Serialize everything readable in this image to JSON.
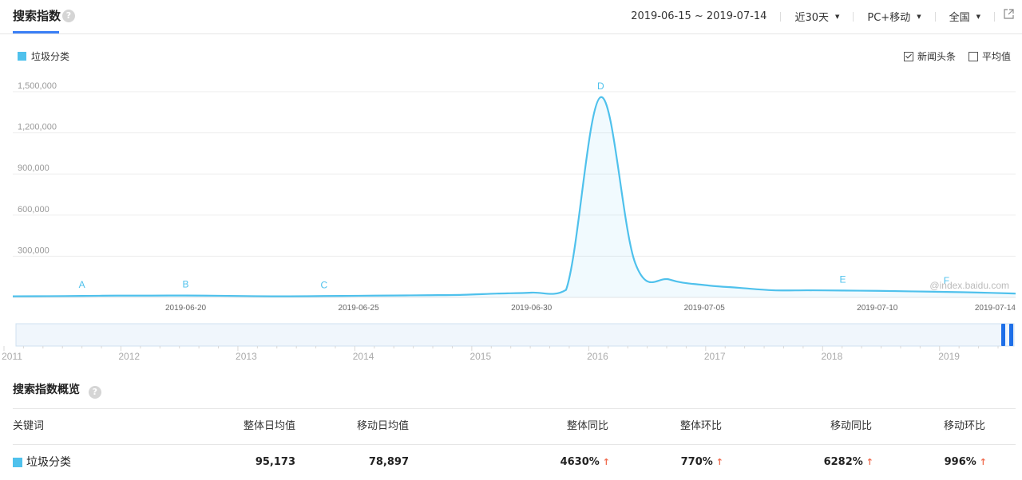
{
  "header": {
    "tab_label": "搜索指数",
    "help_glyph": "?",
    "date_range": "2019-06-15 ~ 2019-07-14",
    "period": "近30天",
    "device": "PC+移动",
    "region": "全国"
  },
  "legend": {
    "series_name": "垃圾分类",
    "color": "#4fc1ec"
  },
  "options": {
    "news_label": "新闻头条",
    "news_checked": true,
    "avg_label": "平均值",
    "avg_checked": false
  },
  "watermark": "@index.baidu.com",
  "chart_data": {
    "type": "area",
    "title": "",
    "xlabel": "",
    "ylabel": "",
    "ylim": [
      0,
      1500000
    ],
    "yticks": [
      "1,500,000",
      "1,200,000",
      "900,000",
      "600,000",
      "300,000"
    ],
    "xticks": [
      "2019-06-20",
      "2019-06-25",
      "2019-06-30",
      "2019-07-05",
      "2019-07-10",
      "2019-07-14"
    ],
    "x": [
      "06-15",
      "06-16",
      "06-17",
      "06-18",
      "06-19",
      "06-20",
      "06-21",
      "06-22",
      "06-23",
      "06-24",
      "06-25",
      "06-26",
      "06-27",
      "06-28",
      "06-29",
      "06-30",
      "07-01",
      "07-02",
      "07-03",
      "07-04",
      "07-05",
      "07-06",
      "07-07",
      "07-08",
      "07-09",
      "07-10",
      "07-11",
      "07-12",
      "07-13",
      "07-14"
    ],
    "series": [
      {
        "name": "垃圾分类",
        "values": [
          8000,
          9000,
          11000,
          13000,
          13000,
          14000,
          12000,
          9000,
          8000,
          10000,
          12000,
          14000,
          16000,
          19000,
          28000,
          35000,
          55000,
          1460000,
          250000,
          130000,
          90000,
          70000,
          52000,
          52000,
          50000,
          48000,
          44000,
          40000,
          35000,
          28000
        ]
      }
    ],
    "annotations": [
      {
        "label": "A",
        "x": "06-17"
      },
      {
        "label": "B",
        "x": "06-20"
      },
      {
        "label": "C",
        "x": "06-24"
      },
      {
        "label": "D",
        "x": "07-02"
      },
      {
        "label": "E",
        "x": "07-09"
      },
      {
        "label": "F",
        "x": "07-12"
      }
    ],
    "grid": true,
    "legend_position": "top-left",
    "overview_years": [
      "2011",
      "2012",
      "2013",
      "2014",
      "2015",
      "2016",
      "2017",
      "2018",
      "2019"
    ]
  },
  "summary": {
    "title": "搜索指数概览",
    "headers": [
      "关键词",
      "整体日均值",
      "移动日均值",
      "整体同比",
      "整体环比",
      "移动同比",
      "移动环比"
    ],
    "row": {
      "keyword": "垃圾分类",
      "overall_daily_avg": "95,173",
      "mobile_daily_avg": "78,897",
      "overall_yoy": "4630%",
      "overall_mom": "770%",
      "mobile_yoy": "6282%",
      "mobile_mom": "996%"
    },
    "up_glyph": "↑"
  }
}
